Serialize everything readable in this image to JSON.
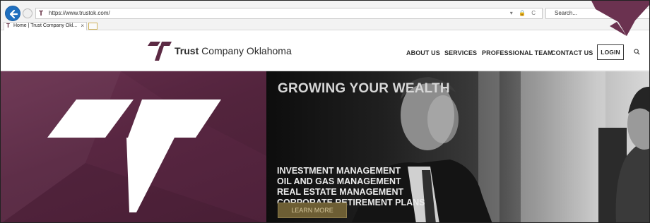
{
  "browser": {
    "url": "https://www.trustok.com/",
    "favicon_glyph": "T",
    "search_placeholder": "Search...",
    "tab_title": "Home | Trust Company Okl...",
    "tab_close": "×",
    "url_icons": "▾ 🔒 C"
  },
  "header": {
    "logo_bold": "Trust",
    "logo_rest": " Company Oklahoma",
    "brand_color": "#5c2a44",
    "nav": {
      "about": "ABOUT US",
      "services": "SERVICES",
      "team": "PROFESSIONAL TEAM",
      "contact": "CONTACT US",
      "login": "LOGIN",
      "search_icon": "search-icon"
    }
  },
  "hero": {
    "title": "GROWING YOUR WEALTH",
    "services": [
      "INVESTMENT MANAGEMENT",
      "OIL AND GAS MANAGEMENT",
      "REAL ESTATE MANAGEMENT",
      "CORPORATE RETIREMENT PLANS"
    ],
    "cta": "LEARN MORE",
    "accent_gold": "#6d5e34"
  },
  "annotation": {
    "arrow_color": "#6b3250"
  }
}
